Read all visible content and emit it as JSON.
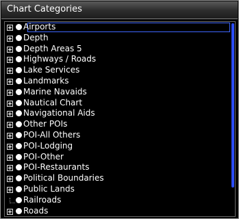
{
  "window": {
    "title": "Chart Categories"
  },
  "list": {
    "items": [
      {
        "label": "Airports",
        "expandable": true,
        "selected": true
      },
      {
        "label": "Depth",
        "expandable": true
      },
      {
        "label": "Depth Areas 5",
        "expandable": true
      },
      {
        "label": "Highways / Roads",
        "expandable": true
      },
      {
        "label": "Lake Services",
        "expandable": true
      },
      {
        "label": "Landmarks",
        "expandable": true
      },
      {
        "label": "Marine Navaids",
        "expandable": true
      },
      {
        "label": "Nautical Chart",
        "expandable": true
      },
      {
        "label": "Navigational Aids",
        "expandable": true
      },
      {
        "label": "Other POIs",
        "expandable": true
      },
      {
        "label": "POI-All Others",
        "expandable": true
      },
      {
        "label": "POI-Lodging",
        "expandable": true
      },
      {
        "label": "POI-Other",
        "expandable": true
      },
      {
        "label": "POI-Restaurants",
        "expandable": true
      },
      {
        "label": "Political Boundaries",
        "expandable": true
      },
      {
        "label": "Public Lands",
        "expandable": true
      },
      {
        "label": "Railroads",
        "expandable": false
      },
      {
        "label": "Roads",
        "expandable": true
      }
    ]
  },
  "colors": {
    "selection": "#3f66ff",
    "scroll_thumb": "#2b4dff",
    "background": "#000000"
  }
}
